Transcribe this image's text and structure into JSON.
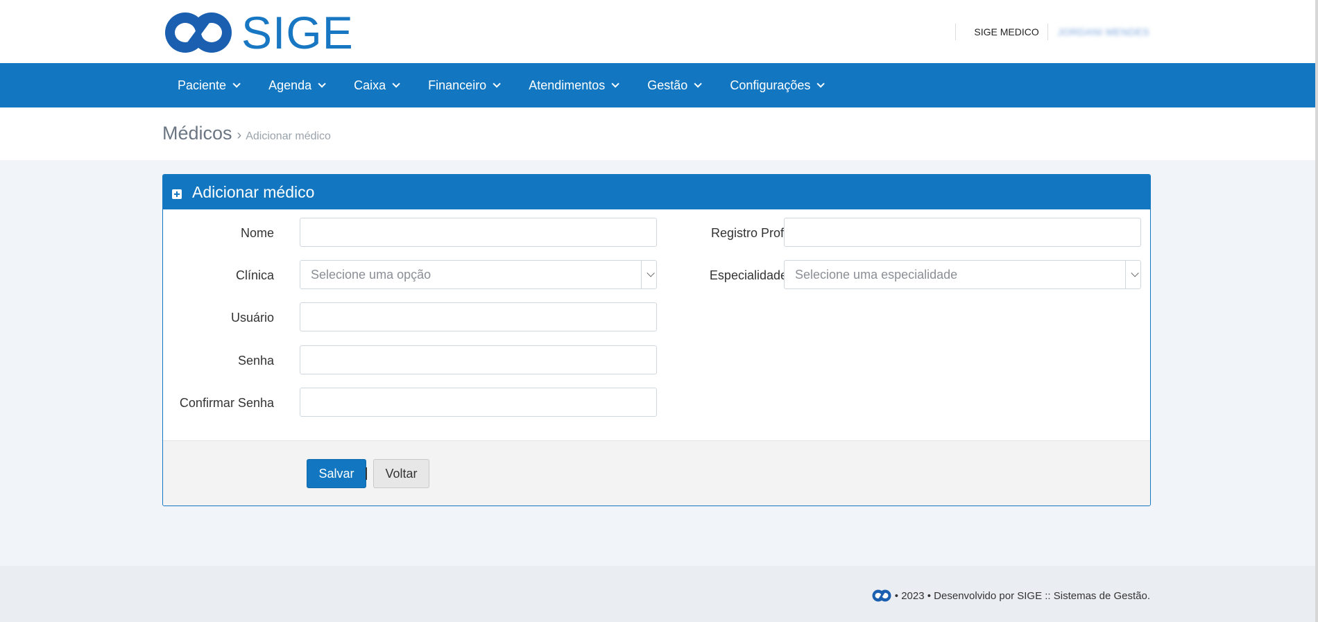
{
  "header": {
    "logo_text": "SIGE",
    "company": "SIGE MEDICO",
    "user": "JORDANI MENDES"
  },
  "nav": {
    "items": [
      {
        "label": "Paciente"
      },
      {
        "label": "Agenda"
      },
      {
        "label": "Caixa"
      },
      {
        "label": "Financeiro"
      },
      {
        "label": "Atendimentos"
      },
      {
        "label": "Gestão"
      },
      {
        "label": "Configurações"
      }
    ]
  },
  "breadcrumb": {
    "title": "Médicos",
    "separator": "›",
    "current": "Adicionar médico"
  },
  "panel": {
    "title": "Adicionar médico",
    "fields": {
      "nome": {
        "label": "Nome",
        "value": ""
      },
      "registro": {
        "label": "Registro Prof.",
        "value": ""
      },
      "clinica": {
        "label": "Clínica",
        "placeholder": "Selecione uma opção"
      },
      "especialidade": {
        "label": "Especialidade",
        "placeholder": "Selecione uma especialidade"
      },
      "usuario": {
        "label": "Usuário",
        "value": ""
      },
      "senha": {
        "label": "Senha",
        "value": ""
      },
      "confirmar": {
        "label": "Confirmar Senha",
        "value": ""
      }
    },
    "buttons": {
      "save": "Salvar",
      "back": "Voltar"
    }
  },
  "footer": {
    "text": "• 2023 • Desenvolvido por SIGE :: Sistemas de Gestão."
  },
  "colors": {
    "brand": "#1277c0",
    "background": "#f1f4f9"
  }
}
